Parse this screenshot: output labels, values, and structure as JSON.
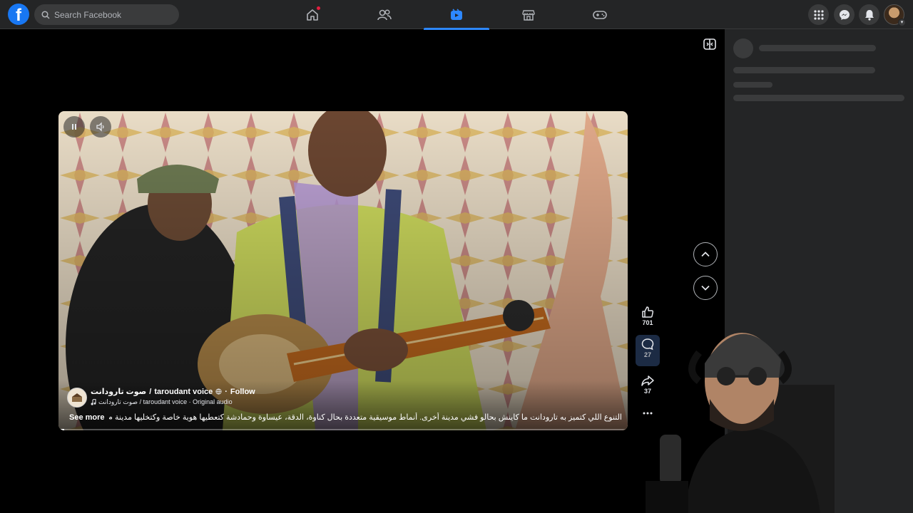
{
  "topbar": {
    "logo_letter": "f",
    "search_placeholder": "Search Facebook",
    "nav_tabs": [
      {
        "icon": "home-icon",
        "has_notification": true,
        "active": false
      },
      {
        "icon": "friends-icon",
        "has_notification": false,
        "active": false
      },
      {
        "icon": "video-icon",
        "has_notification": false,
        "active": true
      },
      {
        "icon": "marketplace-icon",
        "has_notification": false,
        "active": false
      },
      {
        "icon": "gaming-icon",
        "has_notification": false,
        "active": false
      }
    ],
    "right_buttons": [
      "menu-grid-icon",
      "messenger-icon",
      "bell-icon"
    ]
  },
  "reel": {
    "author_arabic": "صوت تارودانت",
    "author_separator": "/",
    "author_latin": "taroudant voice",
    "verified_icon": "globe-icon",
    "follow_label": "Follow",
    "audio_text": "صوت تارودانت / taroudant voice · Original audio",
    "see_more_label": "See more",
    "description": "التنوع اللي كتميز به تارودانت ما كاينش بحالو فشي مدينة أخرى. أنماط موسيقية متعددة بحال كناوة، الدقة، عيساوة وحمادشة كتعطيها هوية خاصة وكتخليها مدينة م...",
    "progress": 0.01
  },
  "actions": {
    "likes": "701",
    "comments": "27",
    "shares": "37"
  },
  "colors": {
    "accent": "#2d88ff",
    "brand": "#1877f2",
    "topbar_bg": "#242526",
    "notification": "#e41e3f"
  }
}
